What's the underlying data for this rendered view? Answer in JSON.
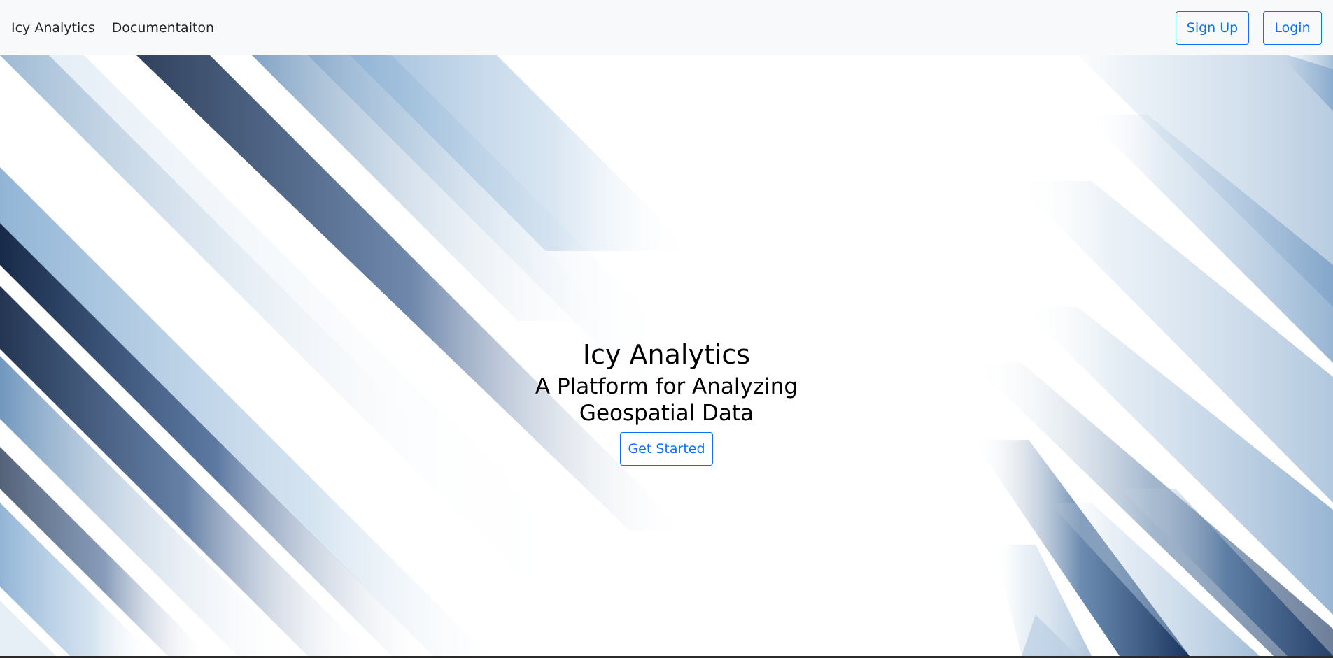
{
  "navbar": {
    "brand": "Icy Analytics",
    "links": [
      "Documentaiton"
    ],
    "signup_label": "Sign Up",
    "login_label": "Login"
  },
  "hero": {
    "title": "Icy Analytics",
    "subtitle": "A Platform for Analyzing Geospatial Data",
    "cta_label": "Get Started"
  },
  "colors": {
    "accent": "#0d6efd",
    "navbar_bg": "#f8f9fa",
    "stripe_light": "#a9c6e0",
    "stripe_mid": "#5b8ab5",
    "stripe_dark": "#14335f",
    "stripe_navy": "#0b1f3f"
  }
}
